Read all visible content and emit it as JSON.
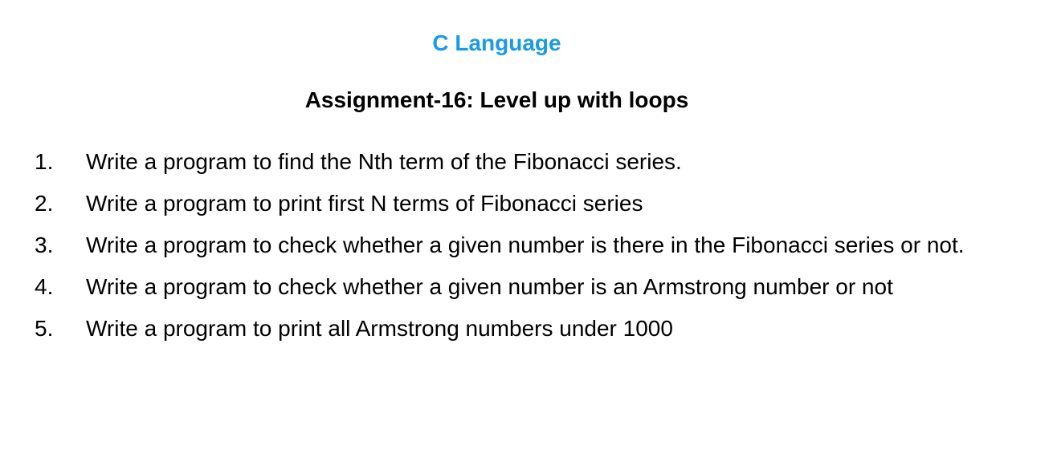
{
  "document": {
    "title": "C Language",
    "title_color": "#1a9be6",
    "subtitle": "Assignment-16: Level up with loops",
    "tasks": [
      {
        "number": "1.",
        "text": "Write a program to find the Nth term of the Fibonacci series."
      },
      {
        "number": "2.",
        "text": "Write a program to print first N terms of Fibonacci series"
      },
      {
        "number": "3.",
        "text": "Write a program to check whether a given number is there in the Fibonacci series or not."
      },
      {
        "number": "4.",
        "text": "Write a program to check whether a given number is an Armstrong number or not"
      },
      {
        "number": "5.",
        "text": "Write a program to print all Armstrong numbers under 1000"
      }
    ]
  }
}
